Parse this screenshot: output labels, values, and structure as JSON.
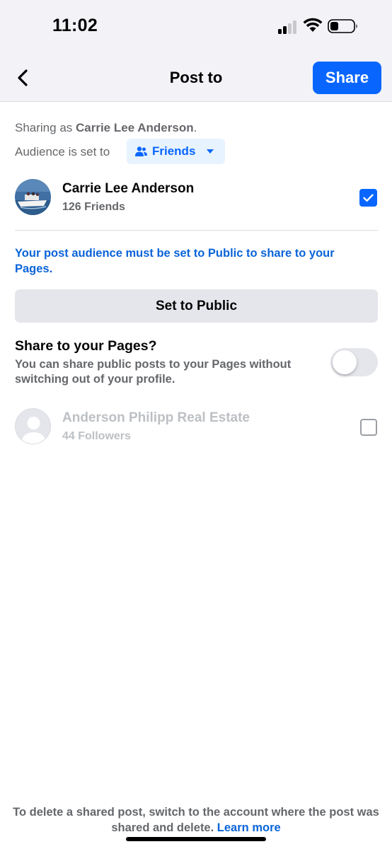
{
  "status_bar": {
    "time": "11:02"
  },
  "nav": {
    "title": "Post to",
    "share_label": "Share"
  },
  "sharing": {
    "prefix": "Sharing as ",
    "name": "Carrie Lee Anderson",
    "suffix": "."
  },
  "audience": {
    "label": "Audience is set to",
    "value": "Friends"
  },
  "profile": {
    "name": "Carrie Lee Anderson",
    "subtitle": "126 Friends",
    "checked": true
  },
  "notice": "Your post audience must be set to Public to share to your Pages.",
  "set_public_label": "Set to Public",
  "pages_section": {
    "heading": "Share to your Pages?",
    "description": "You can share public posts to your Pages without switching out of your profile.",
    "toggle_on": false
  },
  "page": {
    "name": "Anderson Philipp Real Estate",
    "subtitle": "44 Followers",
    "checked": false
  },
  "footer": {
    "text": "To delete a shared post, switch to the account where the post was shared and delete.",
    "link": "Learn more"
  },
  "icons": {
    "back": "chevron-left-icon",
    "audience": "friends-icon",
    "caret": "caret-down-icon",
    "check": "checkmark-icon",
    "page_avatar": "person-placeholder-icon"
  },
  "colors": {
    "brand_blue": "#0866ff",
    "link_blue": "#0a64d8",
    "secondary_text": "#65676b",
    "disabled_text": "#bcc0c4",
    "button_gray": "#e4e6eb",
    "header_bg": "#f2f2f7"
  }
}
